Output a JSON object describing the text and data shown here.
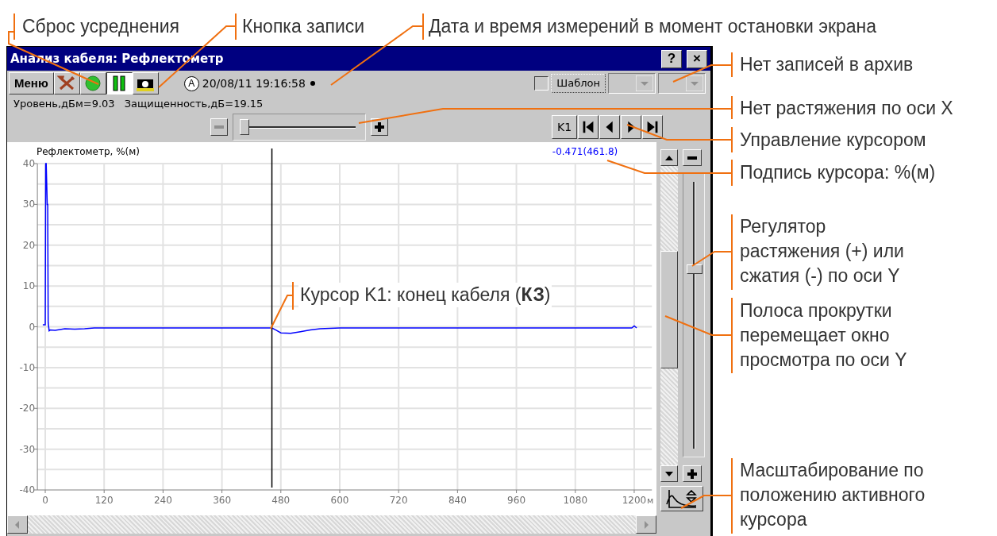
{
  "callouts": [
    {
      "kind": "top",
      "text": "Сброс усреднения"
    },
    {
      "kind": "top",
      "text": "Кнопка записи"
    },
    {
      "kind": "top",
      "text": "Дата и время измерений в момент остановки экрана"
    },
    {
      "kind": "right",
      "text": "Нет записей в архив"
    },
    {
      "kind": "right",
      "text": "Нет растяжения по оси X"
    },
    {
      "kind": "right",
      "text": "Управление курсором"
    },
    {
      "kind": "right",
      "text": "Подпись курсора: %(м)"
    },
    {
      "kind": "right",
      "text": "Регулятор растяжения (+) или сжатия (-) по оси Y"
    },
    {
      "kind": "right",
      "text": "Полоса прокрутки перемещает окно просмотра по оси Y"
    },
    {
      "kind": "right",
      "text": "Масштабирование по положению активного курсора"
    },
    {
      "kind": "inline",
      "text": "Курсор K1: конец кабеля (**КЗ**)"
    }
  ],
  "window": {
    "title": "Анализ кабеля: Рефлектометр",
    "title_buttons": [
      "?",
      "×"
    ]
  },
  "toolbar": {
    "menu_label": "Меню",
    "buttons": [
      {
        "kind": "reset",
        "pressed": false
      },
      {
        "kind": "record",
        "pressed": false
      },
      {
        "kind": "pause",
        "pressed": true
      },
      {
        "kind": "snapshot",
        "pressed": false
      }
    ],
    "mode_badge": "A",
    "timestamp": "20/08/11 19:16:58",
    "template": {
      "checked": false,
      "label": "Шаблон"
    },
    "dropdowns": [
      {
        "disabled": true
      },
      {
        "disabled": true
      }
    ]
  },
  "readings": [
    "Уровень,дБм=9.03",
    "Защищенность,дБ=19.15"
  ],
  "x_zoom": {
    "minus_disabled": true,
    "level": 0
  },
  "cursor_nav": {
    "label": "K1"
  },
  "y_zoom": {
    "level": 0.68
  },
  "chart_data": {
    "type": "line",
    "title": "Рефлектометр, %(м)",
    "xlabel": "м",
    "xlim": [
      -16,
      1236
    ],
    "ylim": [
      -40,
      40
    ],
    "xticks": [
      0,
      120,
      240,
      360,
      480,
      600,
      720,
      840,
      960,
      1080,
      1200
    ],
    "yticks": [
      -40,
      -30,
      -20,
      -10,
      0,
      10,
      20,
      30,
      40
    ],
    "x": [
      -5,
      0,
      1,
      2,
      4,
      5,
      6,
      8,
      10,
      20,
      40,
      60,
      80,
      90,
      100,
      200,
      300,
      400,
      461.8,
      470,
      480,
      500,
      520,
      540,
      560,
      600,
      800,
      1000,
      1195,
      1200,
      1205
    ],
    "grid": true,
    "series": [
      {
        "color": "#0000ff",
        "values": [
          0.5,
          0.5,
          40,
          40,
          30,
          30,
          1,
          -1,
          -0.8,
          -0.9,
          -0.5,
          -0.6,
          -0.5,
          -0.4,
          -0.3,
          -0.3,
          -0.3,
          -0.3,
          -0.3,
          -0.8,
          -1.5,
          -1.6,
          -1.2,
          -0.8,
          -0.5,
          -0.3,
          -0.3,
          -0.3,
          -0.3,
          0.2,
          -0.3
        ]
      }
    ],
    "ref_lines": [
      {
        "axis": "x",
        "value": 461.8,
        "color": "#000000"
      }
    ]
  },
  "cursor_label": "-0.471(461.8)"
}
